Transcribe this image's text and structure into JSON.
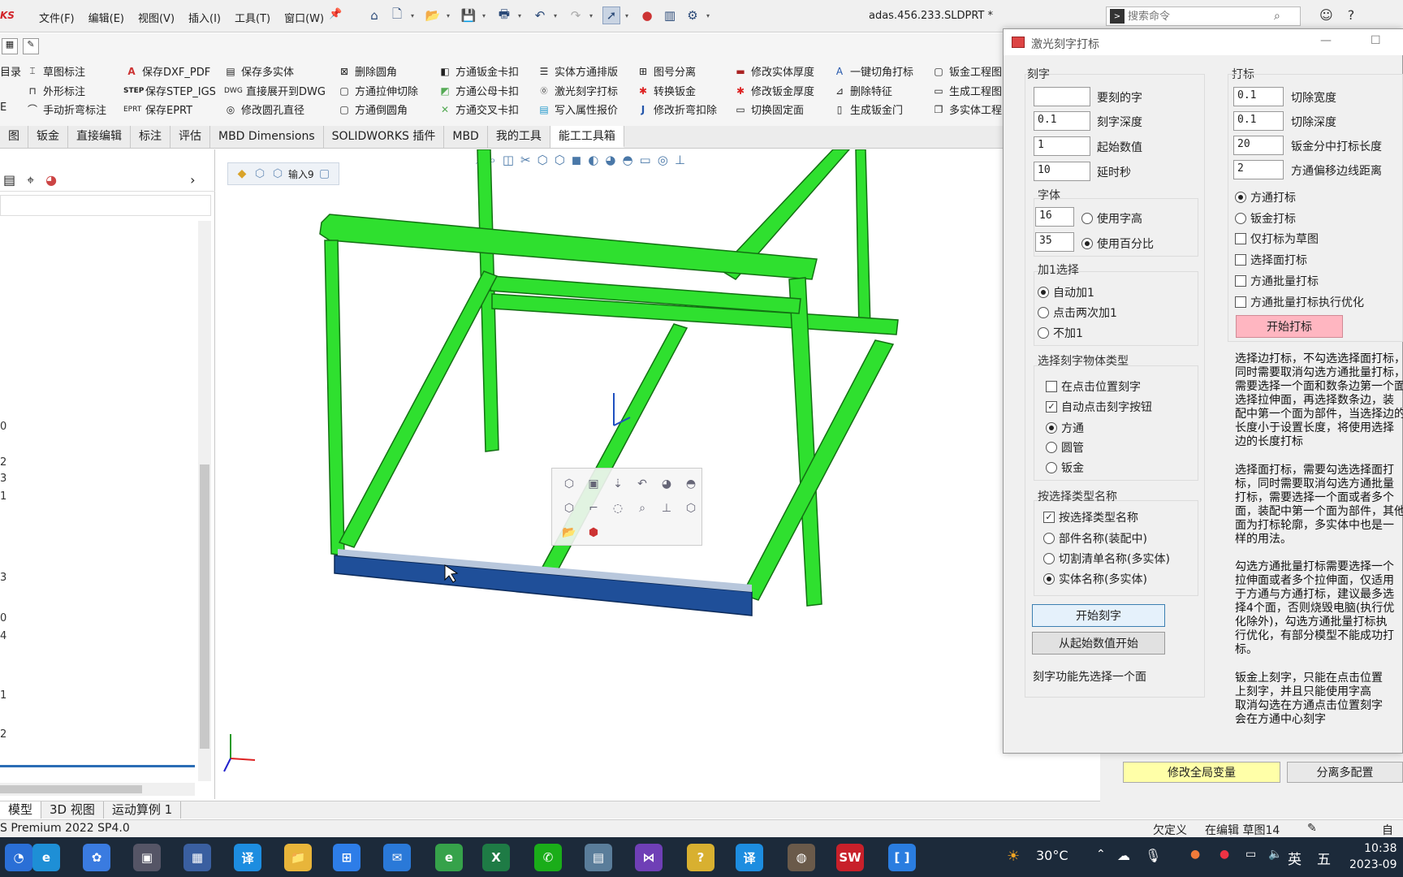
{
  "app": {
    "logo": "KS",
    "menus": [
      "文件(F)",
      "编辑(E)",
      "视图(V)",
      "插入(I)",
      "工具(T)",
      "窗口(W)"
    ],
    "document_title": "adas.456.233.SLDPRT *",
    "search_placeholder": "搜索命令"
  },
  "ribbon": {
    "col0": [
      "目录",
      "",
      "E"
    ],
    "col1": [
      "草图标注",
      "外形标注",
      "手动折弯标注"
    ],
    "col2": [
      "保存DXF_PDF",
      "保存STEP_IGS",
      "保存EPRT"
    ],
    "col2_icons": [
      "A",
      "STEP",
      "EPRT"
    ],
    "col3": [
      "保存多实体",
      "直接展开到DWG",
      "修改圆孔直径"
    ],
    "col3_icons": [
      "▤",
      "DWG",
      "◎"
    ],
    "col4": [
      "删除圆角",
      "方通拉伸切除",
      "方通倒圆角"
    ],
    "col5": [
      "方通钣金卡扣",
      "方通公母卡扣",
      "方通交叉卡扣"
    ],
    "col6": [
      "实体方通排版",
      "激光刻字打标",
      "写入属性报价"
    ],
    "col7": [
      "图号分离",
      "转换钣金",
      "修改折弯扣除"
    ],
    "col8": [
      "修改实体厚度",
      "修改钣金厚度",
      "切换固定面"
    ],
    "col9": [
      "一键切角打标",
      "删除特征",
      "生成钣金门"
    ],
    "col10": [
      "钣金工程图",
      "生成工程图",
      "多实体工程"
    ]
  },
  "tabs": [
    "图",
    "钣金",
    "直接编辑",
    "标注",
    "评估",
    "MBD Dimensions",
    "SOLIDWORKS 插件",
    "MBD",
    "我的工具",
    "能工工具箱"
  ],
  "tree_numbers": [
    "0",
    "2",
    "3",
    "1",
    "3",
    "0",
    "4",
    "1",
    "2"
  ],
  "breadcrumb": {
    "label": "输入9"
  },
  "bottom_tabs": [
    "模型",
    "3D 视图",
    "运动算例 1"
  ],
  "status": {
    "version": "S Premium 2022 SP4.0",
    "state": "欠定义",
    "editing": "在编辑 草图14",
    "custom": "自定"
  },
  "dialog": {
    "title": "激光刻字打标",
    "engrave": {
      "group_label": "刻字",
      "text_value": "",
      "text_label": "要刻的字",
      "depth_value": "0.1",
      "depth_label": "刻字深度",
      "start_value": "1",
      "start_label": "起始数值",
      "delay_value": "10",
      "delay_label": "延时秒",
      "font_group": "字体",
      "font_height_value": "16",
      "font_height_label": "使用字高",
      "font_percent_value": "35",
      "font_percent_label": "使用百分比",
      "plus_group": "加1选择",
      "plus_options": [
        "自动加1",
        "点击两次加1",
        "不加1"
      ],
      "type_group": "选择刻字物体类型",
      "type_checks": [
        "在点击位置刻字",
        "自动点击刻字按钮"
      ],
      "type_options": [
        "方通",
        "圆管",
        "钣金"
      ],
      "name_group": "按选择类型名称",
      "name_check": "按选择类型名称",
      "name_options": [
        "部件名称(装配中)",
        "切割清单名称(多实体)",
        "实体名称(多实体)"
      ],
      "start_button": "开始刻字",
      "from_start_button": "从起始数值开始",
      "hint": "刻字功能先选择一个面"
    },
    "mark": {
      "group_label": "打标",
      "cut_width_value": "0.1",
      "cut_width_label": "切除宽度",
      "cut_depth_value": "0.1",
      "cut_depth_label": "切除深度",
      "sheet_len_value": "20",
      "sheet_len_label": "钣金分中打标长度",
      "offset_value": "2",
      "offset_label": "方通偏移边线距离",
      "options_radio": [
        "方通打标",
        "钣金打标"
      ],
      "options_check": [
        "仅打标为草图",
        "选择面打标",
        "方通批量打标",
        "方通批量打标执行优化"
      ],
      "start_button": "开始打标",
      "help1": [
        "选择边打标，不勾选选择面打标，",
        "同时需要取消勾选方通批量打标，",
        "需要选择一个面和数条边第一个面",
        "选择拉伸面，再选择数条边，装",
        "配中第一个面为部件，当选择边的",
        "长度小于设置长度，将使用选择",
        "边的长度打标"
      ],
      "help2": [
        "选择面打标，需要勾选选择面打",
        "标，同时需要取消勾选方通批量",
        "打标，需要选择一个面或者多个",
        "面，装配中第一个面为部件，其他",
        "面为打标轮廓，多实体中也是一",
        "样的用法。"
      ],
      "help3": [
        "勾选方通批量打标需要选择一个",
        "拉伸面或者多个拉伸面，仅适用",
        "于方通与方通打标，建议最多选",
        "择4个面，否则烧毁电脑(执行优",
        "化除外)，勾选方通批量打标执",
        "行优化，有部分模型不能成功打",
        "标。"
      ],
      "help4": [
        "钣金上刻字，只能在点击位置",
        "上刻字，并且只能使用字高",
        "取消勾选在方通点击位置刻字",
        "会在方通中心刻字"
      ]
    }
  },
  "right_panel": {
    "modify_global": "修改全局变量",
    "split_config": "分离多配置"
  },
  "taskbar": {
    "weather": "30°C",
    "ime": "英",
    "ime2": "五",
    "time": "10:38",
    "date": "2023-09"
  },
  "colors": {
    "frame_green": "#2fe02f",
    "frame_blue": "#1f4f99",
    "pink_button": "#ffb6c1",
    "taskbar": "#1c2a3a"
  }
}
